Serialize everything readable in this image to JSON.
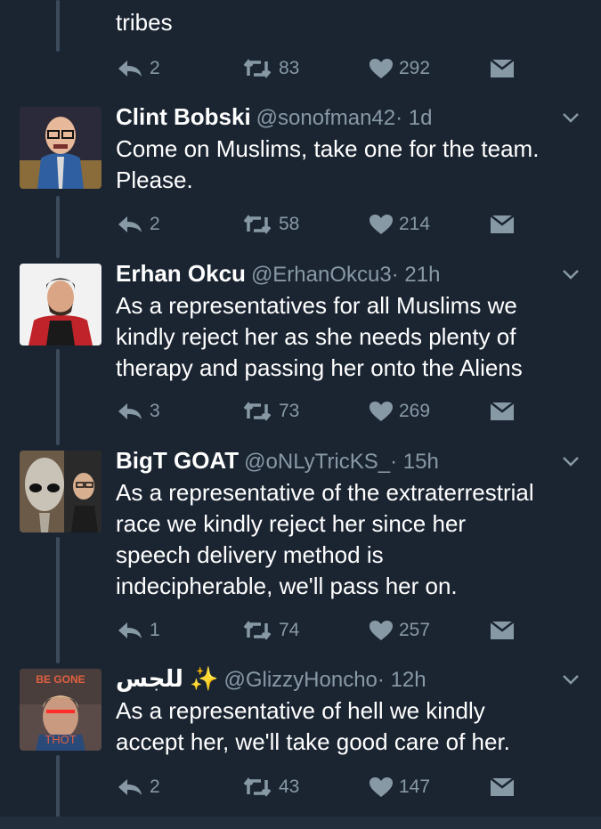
{
  "colors": {
    "background": "#1b2532",
    "text": "#ffffff",
    "muted": "#8899a6",
    "thread_line": "#3c4b5c"
  },
  "top_tweet": {
    "text_tail": "tribes",
    "replies": "2",
    "retweets": "83",
    "likes": "292"
  },
  "tweets": [
    {
      "name": "Clint Bobski",
      "handle": "@sonofman42",
      "time": "· 1d",
      "text": "Come on Muslims, take one for the team.\nPlease.",
      "replies": "2",
      "retweets": "58",
      "likes": "214"
    },
    {
      "name": "Erhan Okcu",
      "handle": "@ErhanOkcu3",
      "time": "· 21h",
      "text": "As a representatives for all Muslims we\nkindly reject her as she needs plenty of\ntherapy and passing her onto the Aliens",
      "replies": "3",
      "retweets": "73",
      "likes": "269"
    },
    {
      "name": "BigT GOAT",
      "handle": "@oNLyTricKS_",
      "time": "· 15h",
      "text": "As a representative of the extraterrestrial\nrace we kindly reject her since her\nspeech delivery method is\nindecipherable, we'll pass her on.",
      "replies": "1",
      "retweets": "74",
      "likes": "257"
    },
    {
      "name": "للجس ✨",
      "handle": "@GlizzyHoncho",
      "time": "· 12h",
      "text": "As a representative of hell we kindly\naccept her, we'll take good care of her.",
      "replies": "2",
      "retweets": "43",
      "likes": "147",
      "avatar_texts": [
        "BE GONE",
        "THOT"
      ]
    }
  ],
  "icons": [
    "reply-icon",
    "retweet-icon",
    "like-icon",
    "direct-message-icon",
    "chevron-down-icon"
  ]
}
